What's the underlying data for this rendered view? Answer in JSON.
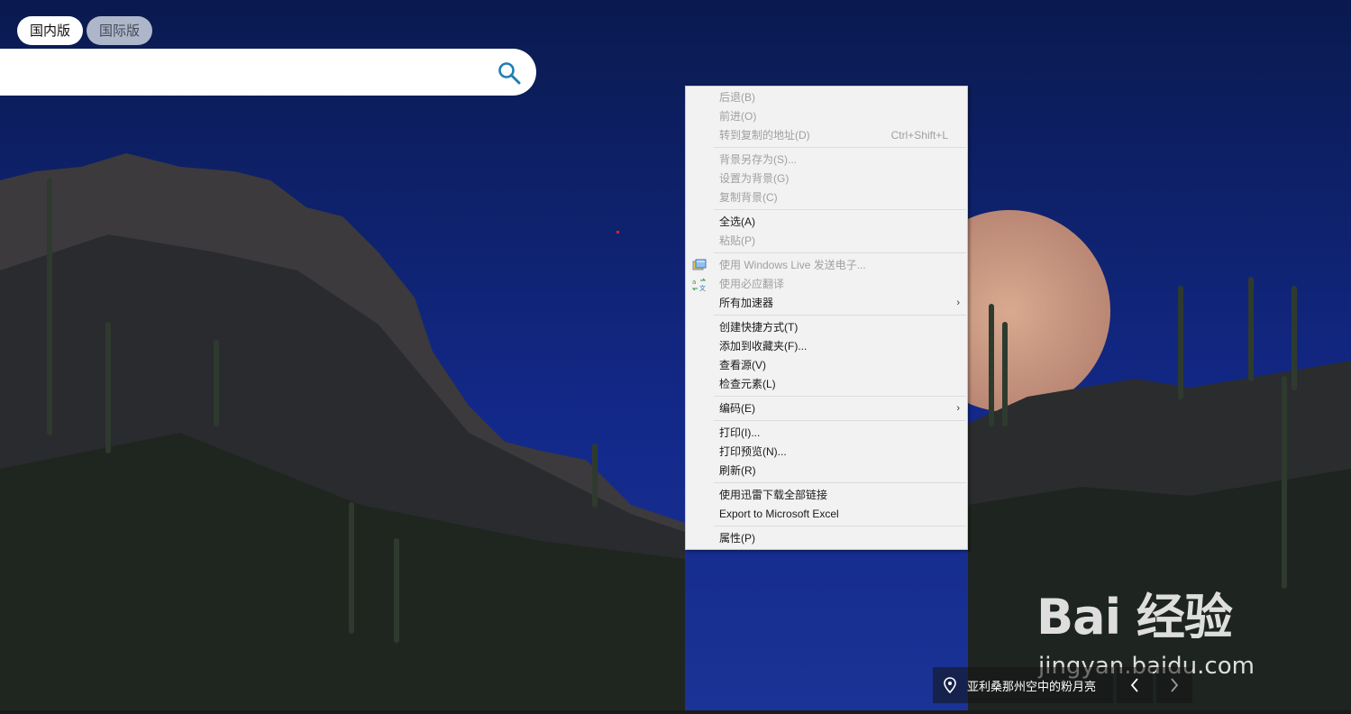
{
  "tabs": [
    {
      "label": "国内版",
      "active": true
    },
    {
      "label": "国际版",
      "active": false
    }
  ],
  "search": {
    "value": "",
    "placeholder": "",
    "icon": "search-icon"
  },
  "context_menu": {
    "groups": [
      [
        {
          "label": "后退(B)",
          "enabled": false
        },
        {
          "label": "前进(O)",
          "enabled": false
        },
        {
          "label": "转到复制的地址(D)",
          "shortcut": "Ctrl+Shift+L",
          "enabled": false
        }
      ],
      [
        {
          "label": "背景另存为(S)...",
          "enabled": false
        },
        {
          "label": "设置为背景(G)",
          "enabled": false
        },
        {
          "label": "复制背景(C)",
          "enabled": false
        }
      ],
      [
        {
          "label": "全选(A)",
          "enabled": true
        },
        {
          "label": "粘贴(P)",
          "enabled": false
        }
      ],
      [
        {
          "label": "使用 Windows Live 发送电子...",
          "enabled": false,
          "icon": "windows-live-icon"
        },
        {
          "label": "使用必应翻译",
          "enabled": false,
          "icon": "bing-translate-icon"
        },
        {
          "label": "所有加速器",
          "enabled": true,
          "submenu": true
        }
      ],
      [
        {
          "label": "创建快捷方式(T)",
          "enabled": true
        },
        {
          "label": "添加到收藏夹(F)...",
          "enabled": true
        },
        {
          "label": "查看源(V)",
          "enabled": true
        },
        {
          "label": "检查元素(L)",
          "enabled": true
        }
      ],
      [
        {
          "label": "编码(E)",
          "enabled": true,
          "submenu": true
        }
      ],
      [
        {
          "label": "打印(I)...",
          "enabled": true
        },
        {
          "label": "打印预览(N)...",
          "enabled": true
        },
        {
          "label": "刷新(R)",
          "enabled": true
        }
      ],
      [
        {
          "label": "使用迅雷下载全部链接",
          "enabled": true
        },
        {
          "label": "Export to Microsoft Excel",
          "enabled": true
        }
      ],
      [
        {
          "label": "属性(P)",
          "enabled": true
        }
      ]
    ],
    "submenu_arrow": "›"
  },
  "caption": {
    "text": "亚利桑那州空中的粉月亮",
    "icon": "location-pin-icon"
  },
  "nav": {
    "prev": "‹",
    "next": "›"
  },
  "watermark": {
    "logo": "Bai 经验",
    "site": "jingyan.baidu.com"
  },
  "colors": {
    "sky": "#0d1f5c",
    "menu_bg": "#f2f2f2",
    "accent": "#1d7fb5"
  }
}
